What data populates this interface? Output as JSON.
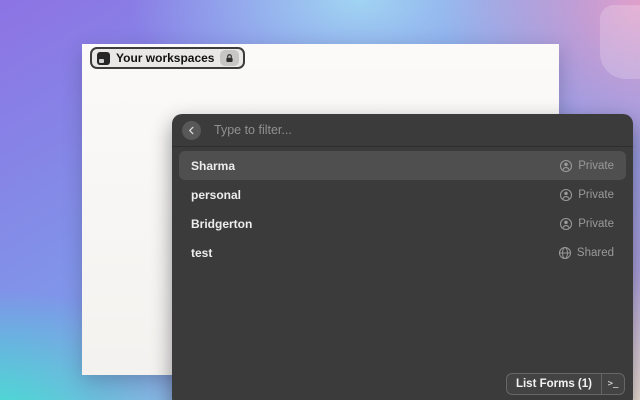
{
  "window": {
    "workspace_pill": {
      "label": "Your workspaces"
    },
    "palette": {
      "filter": {
        "placeholder": "Type to filter..."
      },
      "rows": [
        {
          "name": "Sharma",
          "visibility": "Private",
          "icon": "user-circle",
          "selected": true
        },
        {
          "name": "personal",
          "visibility": "Private",
          "icon": "user-circle",
          "selected": false
        },
        {
          "name": "Bridgerton",
          "visibility": "Private",
          "icon": "user-circle",
          "selected": false
        },
        {
          "name": "test",
          "visibility": "Shared",
          "icon": "globe",
          "selected": false
        }
      ],
      "footer": {
        "action_label": "List Forms (1)",
        "terminal_glyph": ">_"
      }
    }
  },
  "colors": {
    "panel": "#3b3b3b",
    "selected_row": "#4f4f4f",
    "muted_text": "#9a9a9a",
    "pill_background": "#e9e8e7",
    "pill_border": "#3c3c3c",
    "gradient_purple": "#8d73e4",
    "gradient_blue": "#7f97e9",
    "gradient_teal": "#3ee8cf",
    "gradient_pink": "#eba0c7",
    "gradient_cream": "#f4e9d6"
  }
}
